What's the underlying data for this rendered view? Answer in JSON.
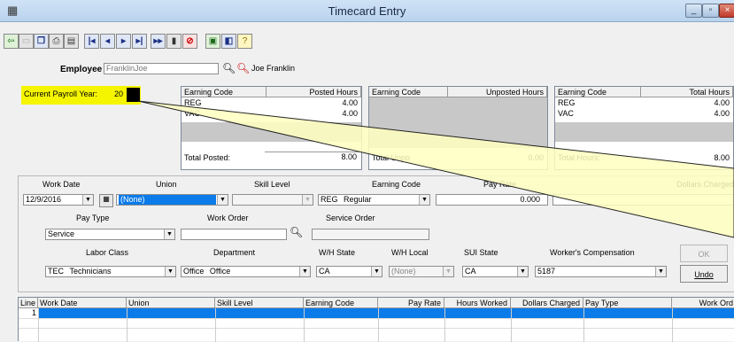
{
  "window": {
    "title": "Timecard Entry",
    "app_icon": "calendar-icon",
    "min": "_",
    "max": "▫",
    "close": "×"
  },
  "toolbar": [
    "save-icon",
    "save-disabled-icon",
    "copy-icon",
    "print-icon",
    "preview-icon",
    "first-record-icon",
    "prev-record-icon",
    "next-record-icon",
    "last-record-icon",
    "goto-record-icon",
    "delete-icon",
    "cancel-icon",
    "new-icon",
    "help-icon",
    "hint-icon"
  ],
  "employee": {
    "label": "Employee",
    "value": "FranklinJoe",
    "name": "Joe Franklin"
  },
  "payroll_year": {
    "label": "Current Payroll Year:",
    "value": "20"
  },
  "posted": {
    "headers": [
      "Earning Code",
      "Posted Hours"
    ],
    "rows": [
      [
        "REG",
        "4.00"
      ],
      [
        "VAC",
        "4.00"
      ]
    ],
    "total_label": "Total Posted:",
    "total": "8.00"
  },
  "unposted": {
    "headers": [
      "Earning Code",
      "Unposted Hours"
    ],
    "total_label": "Total Unpo",
    "total": "0.00"
  },
  "totals": {
    "headers": [
      "Earning Code",
      "Total Hours"
    ],
    "rows": [
      [
        "REG",
        "4.00"
      ],
      [
        "VAC",
        "4.00"
      ]
    ],
    "total_label": "Total Hours:",
    "total": "8.00"
  },
  "entry": {
    "work_date": {
      "label": "Work Date",
      "value": "12/9/2016"
    },
    "union": {
      "label": "Union",
      "value": "(None)"
    },
    "skill_level": {
      "label": "Skill Level",
      "value": ""
    },
    "earning_code": {
      "label": "Earning Code",
      "code": "REG",
      "desc": "Regular"
    },
    "pay_rate": {
      "label": "Pay Rate",
      "value": "0.000"
    },
    "dollars_charged": {
      "label": "Dollars Charged"
    },
    "pay_type": {
      "label": "Pay Type",
      "value": "Service"
    },
    "work_order": {
      "label": "Work Order",
      "value": ""
    },
    "service_order": {
      "label": "Service Order",
      "value": ""
    },
    "labor_class": {
      "label": "Labor Class",
      "code": "TEC",
      "desc": "Technicians"
    },
    "department": {
      "label": "Department",
      "code": "Office",
      "desc": "Office"
    },
    "wh_state": {
      "label": "W/H State",
      "value": "CA"
    },
    "wh_local": {
      "label": "W/H Local",
      "value": "(None)"
    },
    "sui_state": {
      "label": "SUI State",
      "value": "CA"
    },
    "workers_comp": {
      "label": "Worker's Compensation",
      "value": "5187"
    }
  },
  "buttons": {
    "ok": "OK",
    "undo": "Undo"
  },
  "lines": {
    "headers": [
      "Line",
      "Work Date",
      "Union",
      "Skill Level",
      "Earning Code",
      "Pay Rate",
      "Hours Worked",
      "Dollars Charged",
      "Pay Type",
      "Work Ord"
    ],
    "rows": [
      [
        "1",
        "",
        "",
        "",
        "",
        "",
        "",
        "",
        "",
        ""
      ]
    ]
  },
  "colors": {
    "highlight": "#f5f500",
    "selection": "#0a7be9",
    "callout": "#ffffc0"
  }
}
